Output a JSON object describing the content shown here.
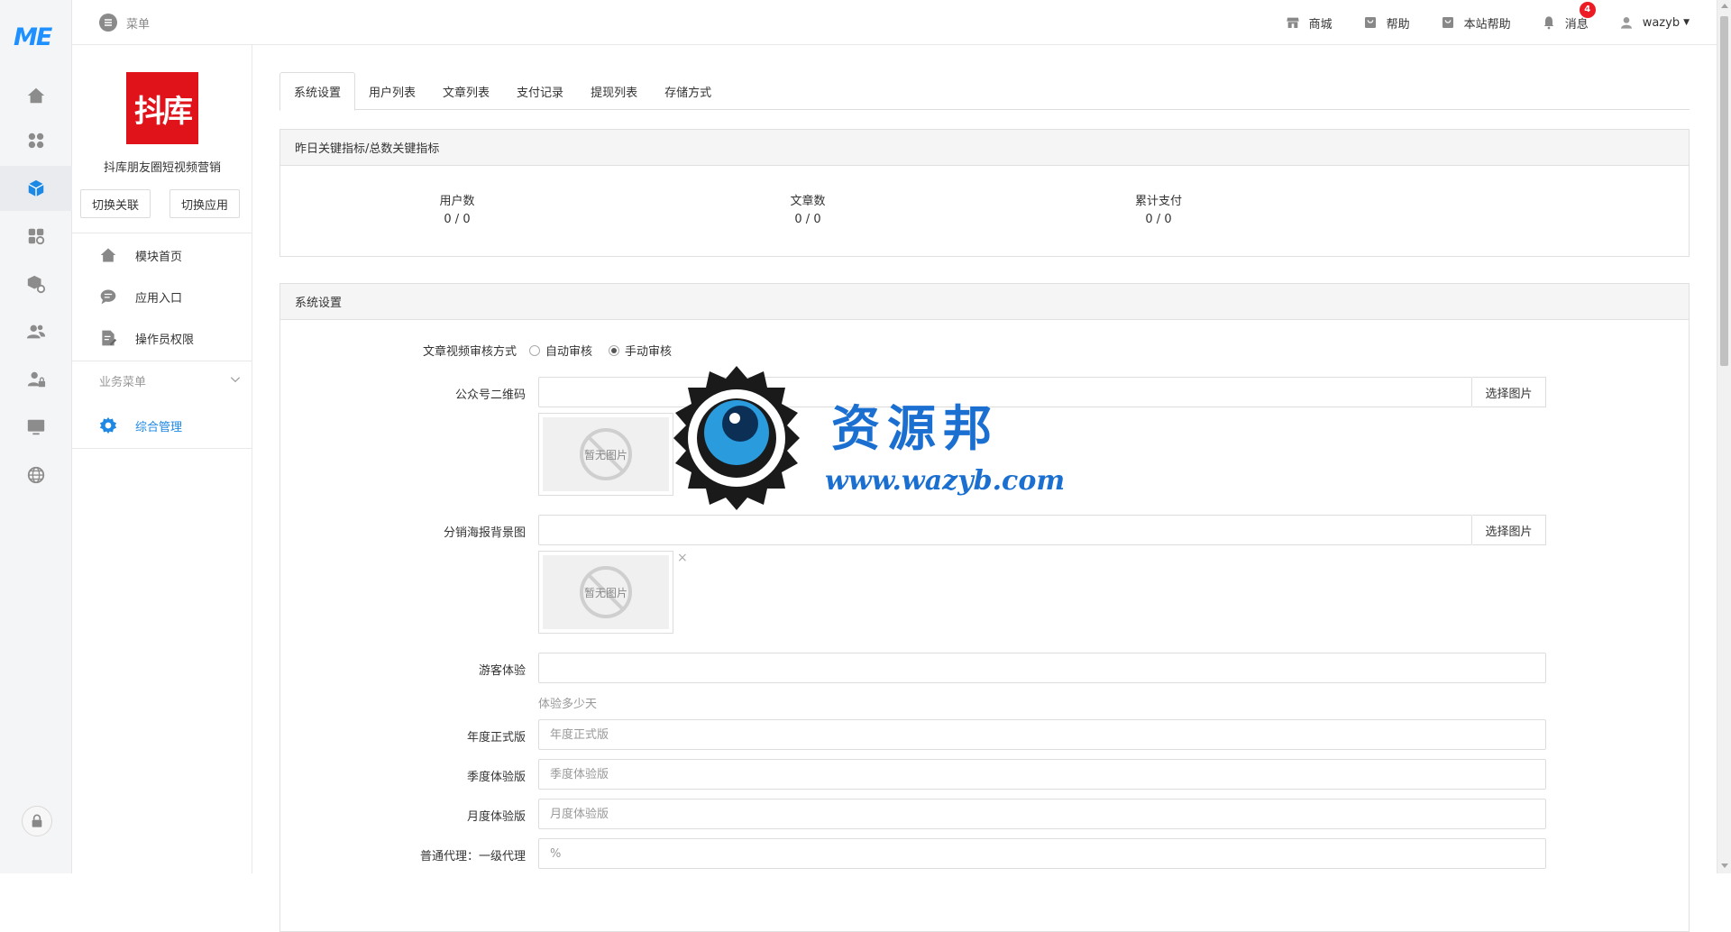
{
  "rail": {
    "logo": "ME"
  },
  "header": {
    "menu_label": "菜单",
    "links": {
      "shop": "商城",
      "help": "帮助",
      "site_help": "本站帮助",
      "messages": "消息",
      "messages_badge": "4",
      "user": "wazyb"
    }
  },
  "sidebar": {
    "app_logo_text": "抖库",
    "app_name": "抖库朋友圈短视频营销",
    "switch_link": "切换关联",
    "switch_app": "切换应用",
    "items": [
      {
        "label": "模块首页"
      },
      {
        "label": "应用入口"
      },
      {
        "label": "操作员权限"
      }
    ],
    "group_label": "业务菜单",
    "group_items": [
      {
        "label": "综合管理"
      }
    ]
  },
  "tabs": [
    "系统设置",
    "用户列表",
    "文章列表",
    "支付记录",
    "提现列表",
    "存储方式"
  ],
  "stats_panel": {
    "title": "昨日关键指标/总数关键指标",
    "stats": [
      {
        "label": "用户数",
        "value": "0 / 0"
      },
      {
        "label": "文章数",
        "value": "0 / 0"
      },
      {
        "label": "累计支付",
        "value": "0 / 0"
      }
    ]
  },
  "settings_panel": {
    "title": "系统设置",
    "review_label": "文章视频审核方式",
    "review_options": [
      "自动审核",
      "手动审核"
    ],
    "review_selected": "手动审核",
    "qrcode_label": "公众号二维码",
    "qrcode_value": "",
    "poster_label": "分销海报背景图",
    "poster_value": "",
    "choose_image": "选择图片",
    "no_image": "暂无图片",
    "remove": "×",
    "guest_label": "游客体验",
    "guest_value": "",
    "guest_help": "体验多少天",
    "annual_label": "年度正式版",
    "annual_placeholder": "年度正式版",
    "quarter_label": "季度体验版",
    "quarter_placeholder": "季度体验版",
    "month_label": "月度体验版",
    "month_placeholder": "月度体验版",
    "agent_label": "普通代理：一级代理",
    "agent_placeholder": "%"
  },
  "watermark": {
    "title": "资源邦",
    "url": "www.wazyb.com"
  },
  "colors": {
    "accent": "#1e88e5",
    "badge": "#ed1c24",
    "app_logo_bg": "#e0131b",
    "watermark_blue": "#1a6fd0"
  }
}
